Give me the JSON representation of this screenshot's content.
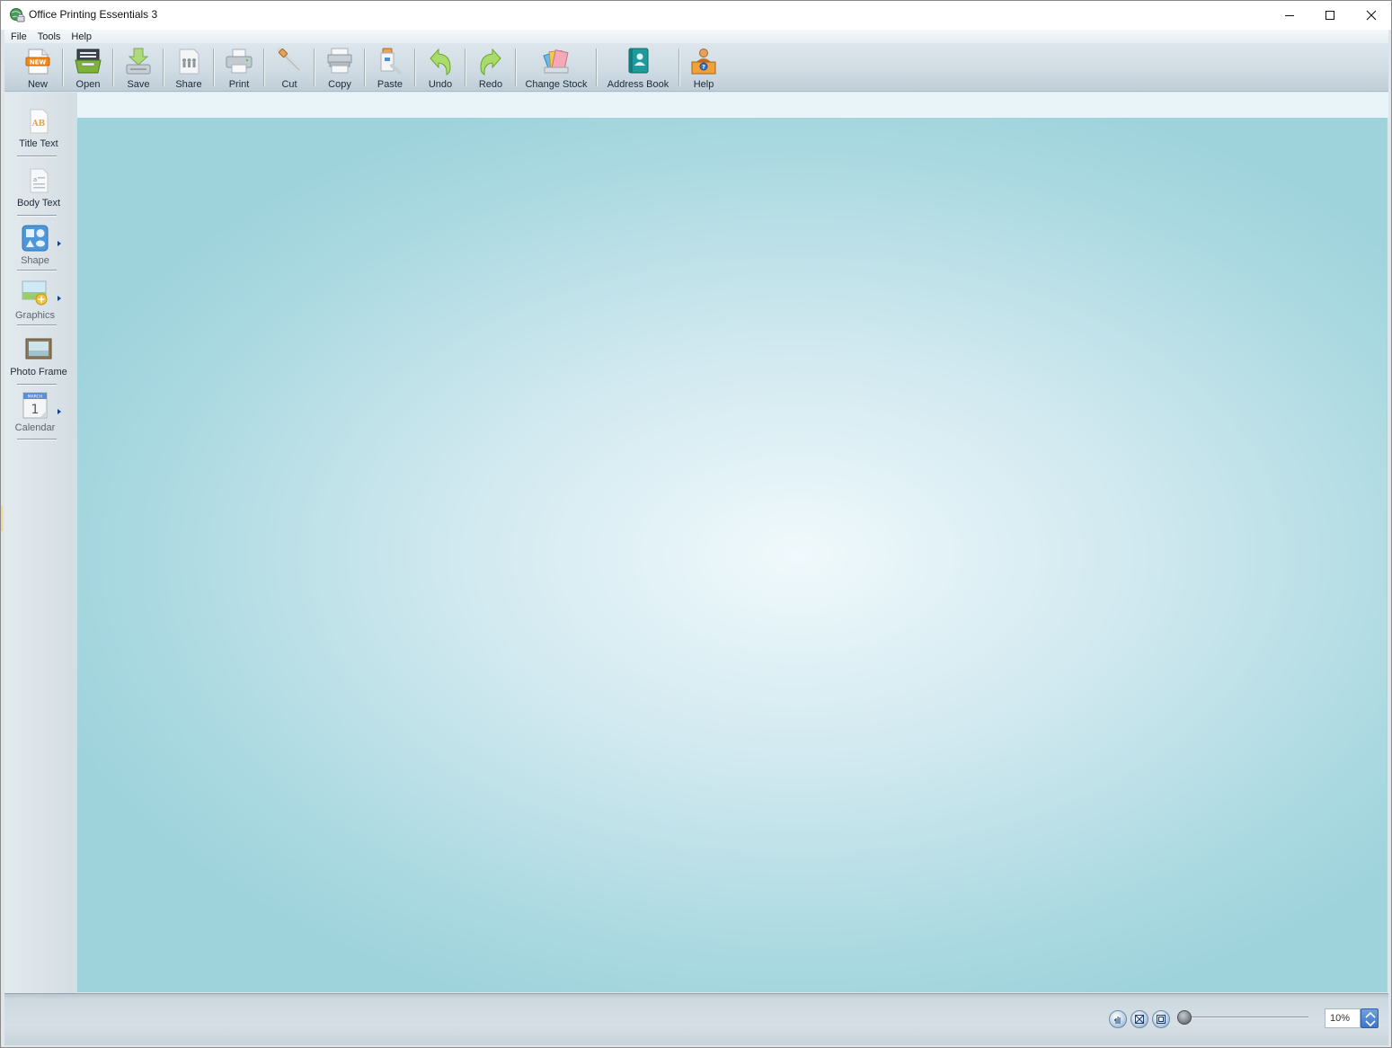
{
  "window": {
    "title": "Office Printing Essentials 3",
    "app_icon": "globe-printer-icon"
  },
  "menu": {
    "items": [
      "File",
      "Tools",
      "Help"
    ]
  },
  "toolbar": {
    "buttons": [
      {
        "label": "New",
        "icon": "new-document-icon"
      },
      {
        "label": "Open",
        "icon": "open-folder-icon"
      },
      {
        "label": "Save",
        "icon": "save-icon"
      },
      {
        "label": "Share",
        "icon": "share-icon"
      },
      {
        "label": "Print",
        "icon": "printer-icon"
      },
      {
        "label": "Cut",
        "icon": "cut-icon"
      },
      {
        "label": "Copy",
        "icon": "copy-icon"
      },
      {
        "label": "Paste",
        "icon": "paste-icon"
      },
      {
        "label": "Undo",
        "icon": "undo-icon"
      },
      {
        "label": "Redo",
        "icon": "redo-icon"
      },
      {
        "label": "Change Stock",
        "icon": "paper-stock-icon"
      },
      {
        "label": "Address Book",
        "icon": "address-book-icon"
      },
      {
        "label": "Help",
        "icon": "help-desk-icon"
      }
    ]
  },
  "palette": {
    "items": [
      {
        "label": "Title Text",
        "icon": "title-text-icon",
        "has_submenu": false
      },
      {
        "label": "Body Text",
        "icon": "body-text-icon",
        "has_submenu": false
      },
      {
        "label": "Shape",
        "icon": "shape-icon",
        "has_submenu": true
      },
      {
        "label": "Graphics",
        "icon": "graphics-icon",
        "has_submenu": true
      },
      {
        "label": "Photo Frame",
        "icon": "photo-frame-icon",
        "has_submenu": false
      },
      {
        "label": "Calendar",
        "icon": "calendar-icon",
        "has_submenu": true
      }
    ]
  },
  "statusbar": {
    "tools": [
      "pan-hand-icon",
      "fit-page-icon",
      "actual-size-icon"
    ],
    "zoom_value": "10%",
    "zoom_slider_fraction": 0.0
  },
  "colors": {
    "canvas_center": "#f0f9fc",
    "canvas_edge": "#9fd3dc",
    "toolbar_bg": "#cfdbe3",
    "zoom_spin": "#4a80d0"
  }
}
